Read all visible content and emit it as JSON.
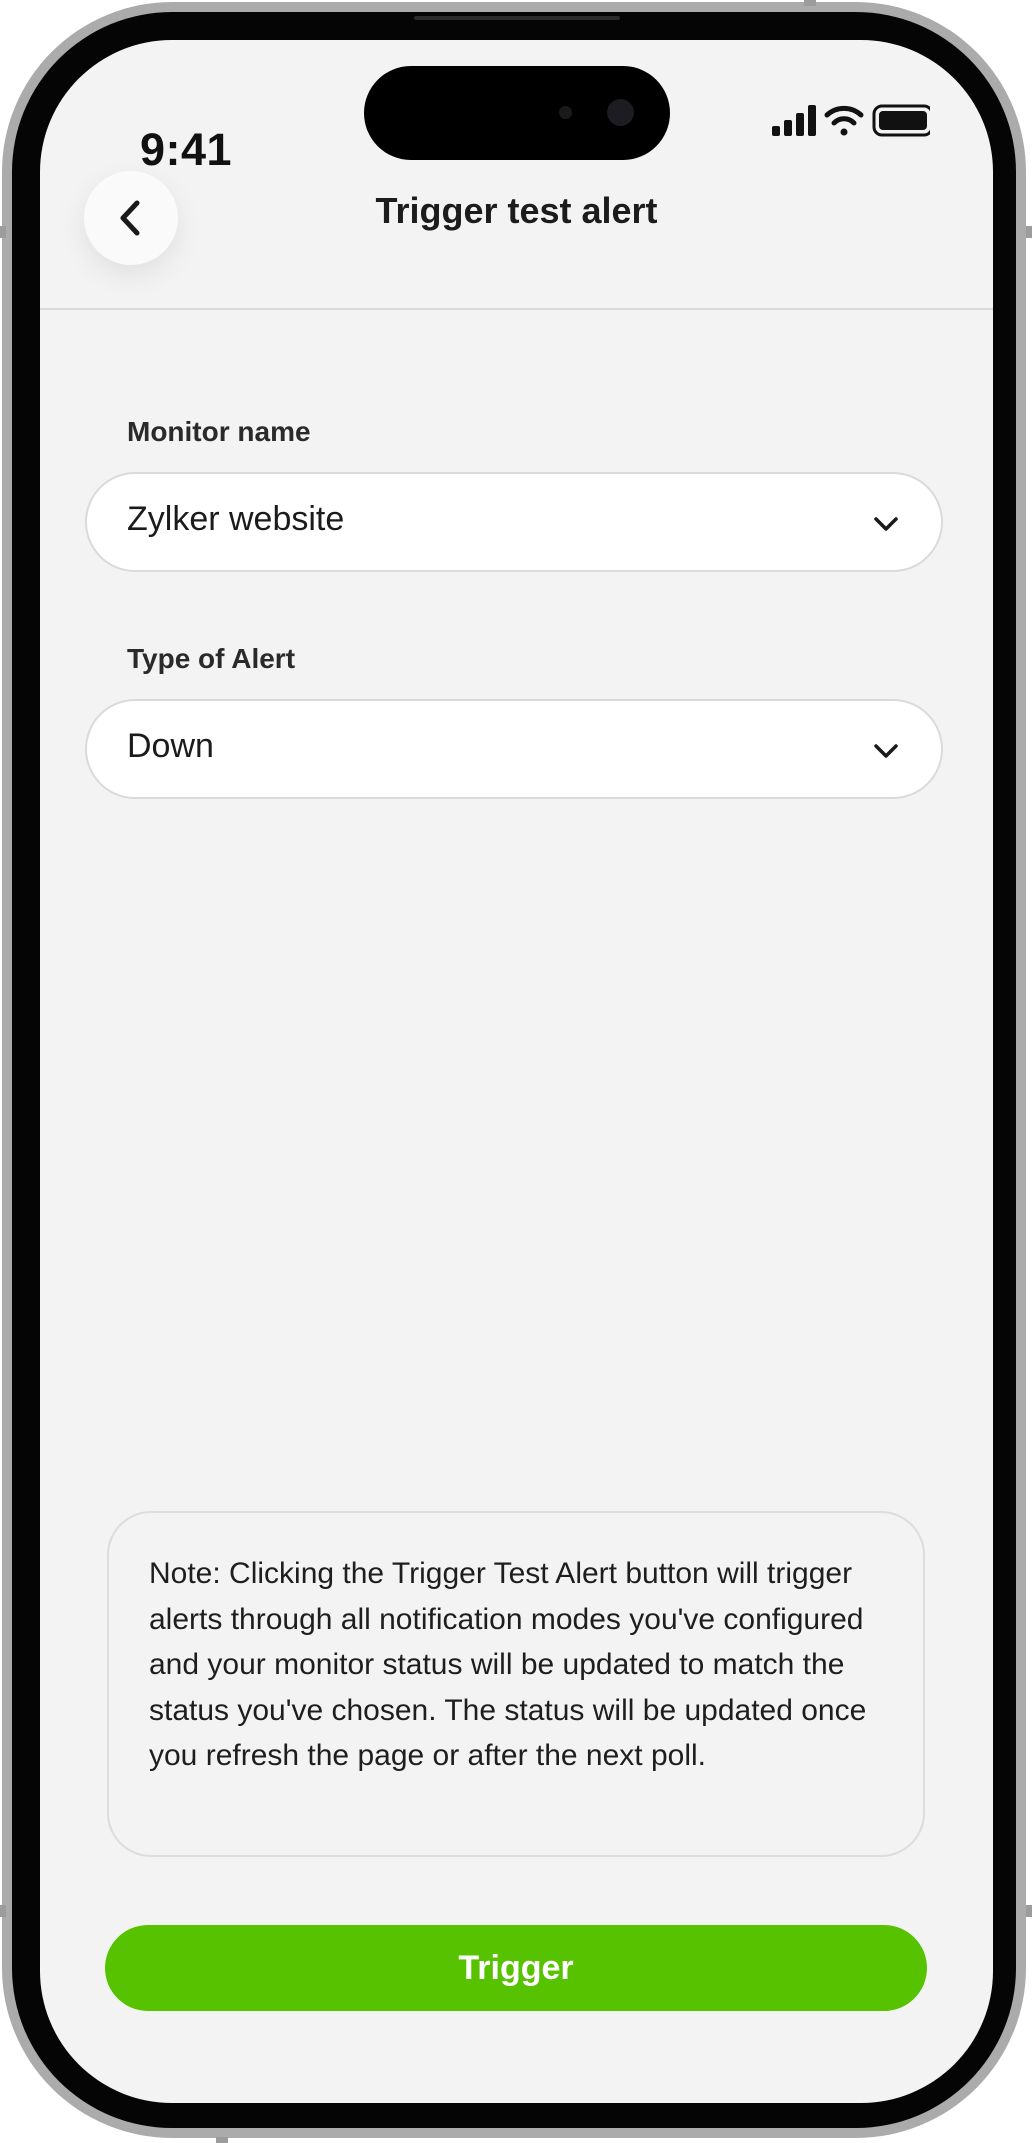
{
  "status_bar": {
    "time": "9:41",
    "icons": [
      "cellular-signal-icon",
      "wifi-icon",
      "battery-icon"
    ]
  },
  "header": {
    "back_icon": "chevron-left-icon",
    "title": "Trigger test alert"
  },
  "form": {
    "monitor": {
      "label": "Monitor name",
      "value": "Zylker website",
      "icon": "chevron-down-icon"
    },
    "alert_type": {
      "label": "Type of Alert",
      "value": "Down",
      "icon": "chevron-down-icon"
    }
  },
  "note": {
    "text": "Note: Clicking the Trigger Test Alert button will trigger alerts through all notification modes you've configured and your monitor status will be updated to match the status you've chosen. The status will be updated once you refresh the page or after the next poll."
  },
  "actions": {
    "trigger_label": "Trigger"
  },
  "colors": {
    "accent": "#57c300",
    "background": "#f3f3f3",
    "field_background": "#ffffff",
    "border": "#dadada",
    "text": "#1b1b1b"
  }
}
